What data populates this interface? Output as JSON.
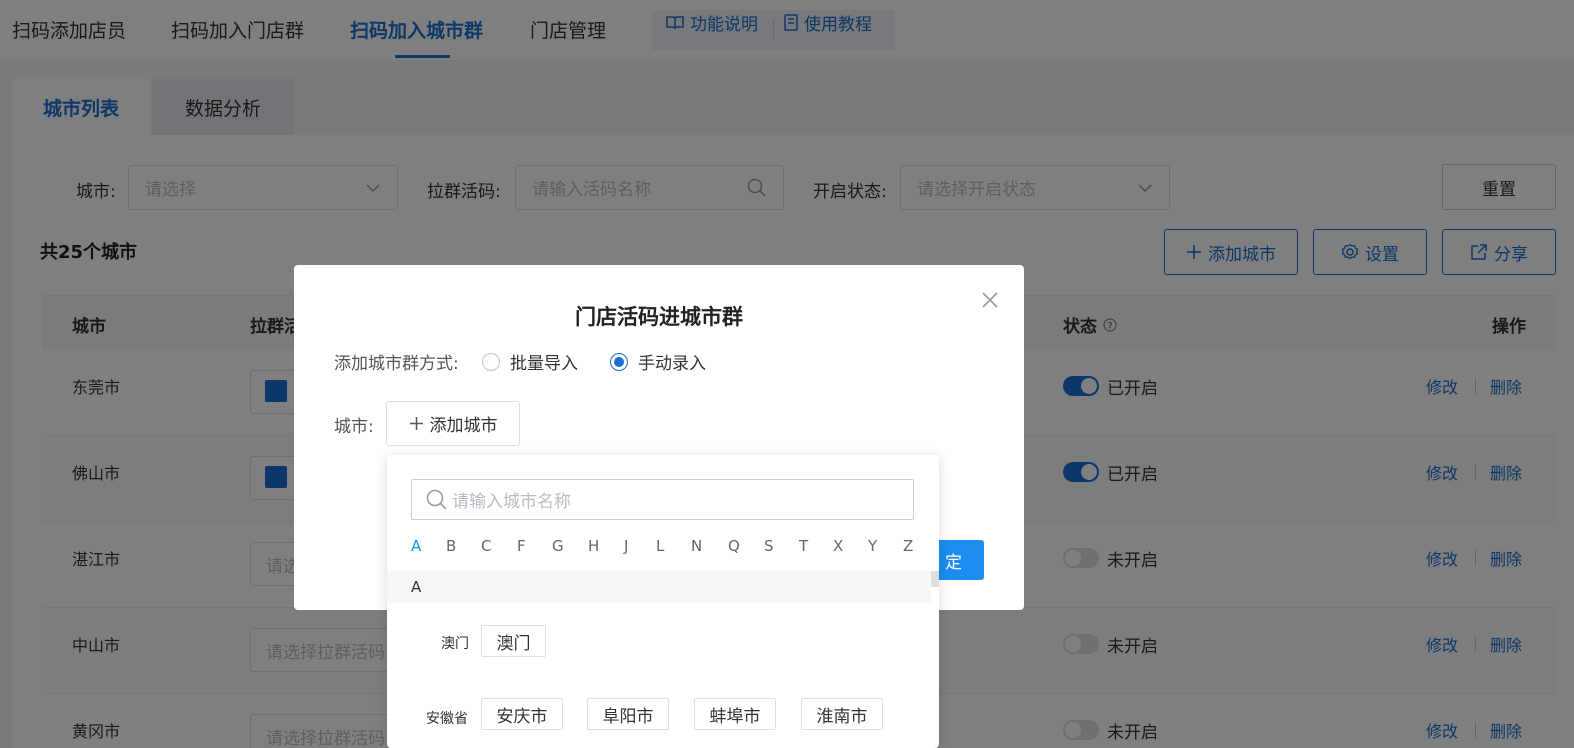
{
  "topnav": {
    "tabs": [
      "扫码添加店员",
      "扫码加入门店群",
      "扫码加入城市群",
      "门店管理"
    ],
    "help": [
      "功能说明",
      "使用教程"
    ]
  },
  "subtabs": [
    "城市列表",
    "数据分析"
  ],
  "filters": {
    "city_label": "城市:",
    "city_placeholder": "请选择",
    "code_label": "拉群活码:",
    "code_placeholder": "请输入活码名称",
    "status_label": "开启状态:",
    "status_placeholder": "请选择开启状态",
    "reset": "重置"
  },
  "summary": "共25个城市",
  "actions": {
    "add": "添加城市",
    "settings": "设置",
    "share": "分享"
  },
  "table": {
    "headers": {
      "city": "城市",
      "code": "拉群活",
      "status": "状态",
      "ops": "操作"
    },
    "rows": [
      {
        "city": "东莞市",
        "code": "",
        "status": "已开启",
        "on": true
      },
      {
        "city": "佛山市",
        "code": "",
        "status": "已开启",
        "on": true
      },
      {
        "city": "湛江市",
        "code": "请选",
        "status": "未开启",
        "on": false
      },
      {
        "city": "中山市",
        "code": "请选择拉群活码",
        "status": "未开启",
        "on": false
      },
      {
        "city": "黄冈市",
        "code": "请选择拉群活码",
        "status": "未开启",
        "on": false
      }
    ],
    "edit": "修改",
    "delete": "删除"
  },
  "modal": {
    "title": "门店活码进城市群",
    "method_label": "添加城市群方式:",
    "option_batch": "批量导入",
    "option_manual": "手动录入",
    "city_label": "城市:",
    "add_city": "添加城市",
    "ok_partial": "定"
  },
  "dropdown": {
    "search_placeholder": "请输入城市名称",
    "letters": [
      "A",
      "B",
      "C",
      "F",
      "G",
      "H",
      "J",
      "L",
      "N",
      "Q",
      "S",
      "T",
      "X",
      "Y",
      "Z"
    ],
    "active_letter": "A",
    "group": "A",
    "provinces": [
      {
        "name": "澳门",
        "cities": [
          "澳门"
        ]
      },
      {
        "name": "安徽省",
        "cities": [
          "安庆市",
          "阜阳市",
          "蚌埠市",
          "淮南市"
        ]
      }
    ]
  },
  "colors": {
    "primary": "#1b6fd0",
    "confirm": "#1b8cf0"
  }
}
